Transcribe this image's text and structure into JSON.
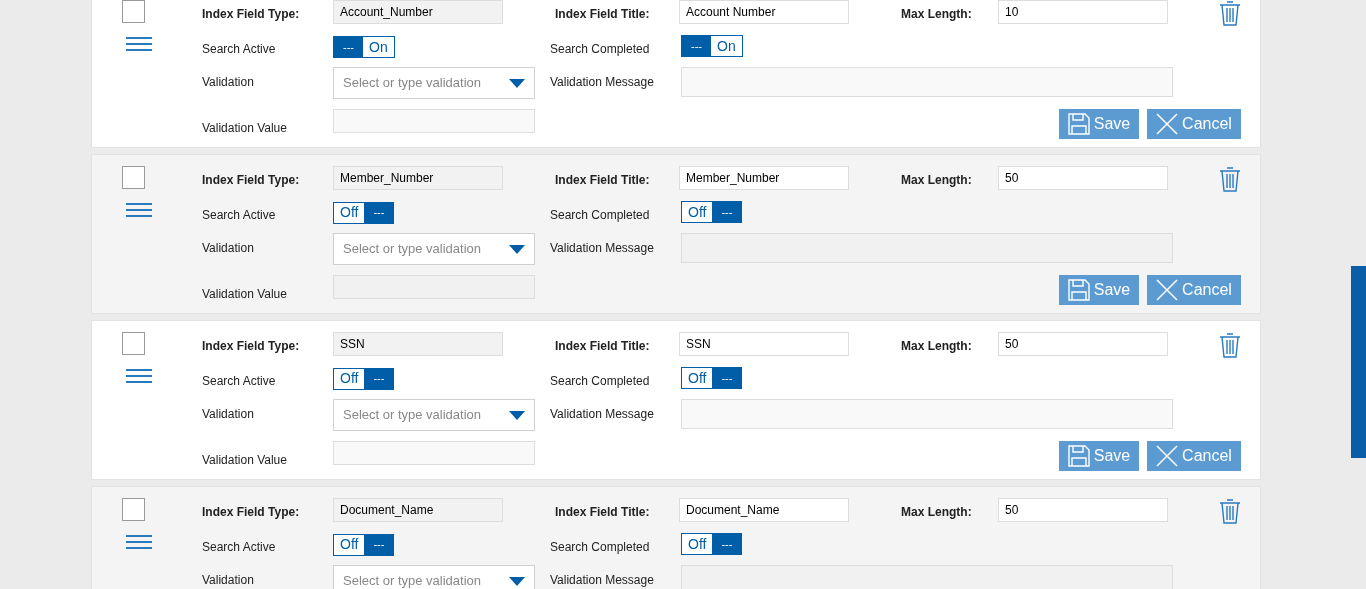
{
  "records": [
    {
      "checked": false,
      "type_label": "Index Field Type:",
      "type_value": "Account_Number",
      "title_label": "Index Field Title:",
      "title_value": "Account Number",
      "max_label": "Max Length:",
      "max_value": "10",
      "search_active_label": "Search Active",
      "search_active": {
        "on": true,
        "text": "On",
        "knob": "---"
      },
      "search_completed_label": "Search Completed",
      "search_completed": {
        "on": true,
        "text": "On",
        "knob": "---"
      },
      "validation_label": "Validation",
      "validation_placeholder": "Select or type validation",
      "message_label": "Validation Message",
      "value_label": "Validation Value",
      "save": "Save",
      "cancel": "Cancel"
    },
    {
      "checked": false,
      "type_label": "Index Field Type:",
      "type_value": "Member_Number",
      "title_label": "Index Field Title:",
      "title_value": "Member_Number",
      "max_label": "Max Length:",
      "max_value": "50",
      "search_active_label": "Search Active",
      "search_active": {
        "on": false,
        "text": "Off",
        "knob": "---"
      },
      "search_completed_label": "Search Completed",
      "search_completed": {
        "on": false,
        "text": "Off",
        "knob": "---"
      },
      "validation_label": "Validation",
      "validation_placeholder": "Select or type validation",
      "message_label": "Validation Message",
      "value_label": "Validation Value",
      "save": "Save",
      "cancel": "Cancel"
    },
    {
      "checked": false,
      "type_label": "Index Field Type:",
      "type_value": "SSN",
      "title_label": "Index Field Title:",
      "title_value": "SSN",
      "max_label": "Max Length:",
      "max_value": "50",
      "search_active_label": "Search Active",
      "search_active": {
        "on": false,
        "text": "Off",
        "knob": "---"
      },
      "search_completed_label": "Search Completed",
      "search_completed": {
        "on": false,
        "text": "Off",
        "knob": "---"
      },
      "validation_label": "Validation",
      "validation_placeholder": "Select or type validation",
      "message_label": "Validation Message",
      "value_label": "Validation Value",
      "save": "Save",
      "cancel": "Cancel"
    },
    {
      "checked": false,
      "type_label": "Index Field Type:",
      "type_value": "Document_Name",
      "title_label": "Index Field Title:",
      "title_value": "Document_Name",
      "max_label": "Max Length:",
      "max_value": "50",
      "search_active_label": "Search Active",
      "search_active": {
        "on": false,
        "text": "Off",
        "knob": "---"
      },
      "search_completed_label": "Search Completed",
      "search_completed": {
        "on": false,
        "text": "Off",
        "knob": "---"
      },
      "validation_label": "Validation",
      "validation_placeholder": "Select or type validation",
      "message_label": "Validation Message"
    }
  ]
}
